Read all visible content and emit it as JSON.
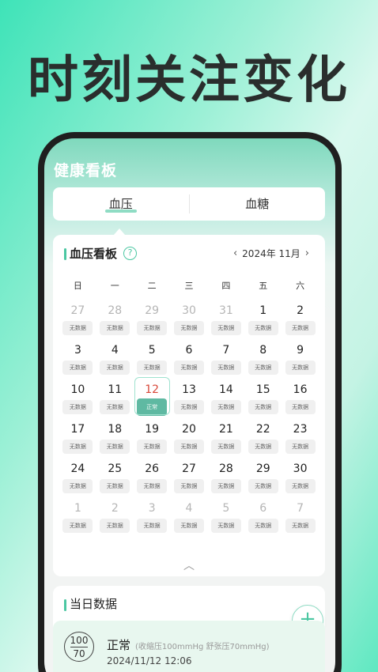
{
  "headline": "时刻关注变化",
  "app": {
    "title": "健康看板",
    "tabs": [
      {
        "label": "血压",
        "active": true
      },
      {
        "label": "血糖",
        "active": false
      }
    ]
  },
  "board": {
    "title": "血压看板",
    "help_icon": "question-circle-icon",
    "month": "2024年 11月",
    "prev_icon": "chevron-left-icon",
    "next_icon": "chevron-right-icon",
    "weekdays": [
      "日",
      "一",
      "二",
      "三",
      "四",
      "五",
      "六"
    ],
    "no_data": "无数据",
    "today_tag": "正常",
    "weeks": [
      [
        {
          "d": "27",
          "o": true
        },
        {
          "d": "28",
          "o": true
        },
        {
          "d": "29",
          "o": true
        },
        {
          "d": "30",
          "o": true
        },
        {
          "d": "31",
          "o": true
        },
        {
          "d": "1"
        },
        {
          "d": "2"
        }
      ],
      [
        {
          "d": "3"
        },
        {
          "d": "4"
        },
        {
          "d": "5"
        },
        {
          "d": "6"
        },
        {
          "d": "7"
        },
        {
          "d": "8"
        },
        {
          "d": "9"
        }
      ],
      [
        {
          "d": "10"
        },
        {
          "d": "11"
        },
        {
          "d": "12",
          "today": true
        },
        {
          "d": "13"
        },
        {
          "d": "14"
        },
        {
          "d": "15"
        },
        {
          "d": "16"
        }
      ],
      [
        {
          "d": "17"
        },
        {
          "d": "18"
        },
        {
          "d": "19"
        },
        {
          "d": "20"
        },
        {
          "d": "21"
        },
        {
          "d": "22"
        },
        {
          "d": "23"
        }
      ],
      [
        {
          "d": "24"
        },
        {
          "d": "25"
        },
        {
          "d": "26"
        },
        {
          "d": "27"
        },
        {
          "d": "28"
        },
        {
          "d": "29"
        },
        {
          "d": "30"
        }
      ],
      [
        {
          "d": "1",
          "o": true
        },
        {
          "d": "2",
          "o": true
        },
        {
          "d": "3",
          "o": true
        },
        {
          "d": "4",
          "o": true
        },
        {
          "d": "5",
          "o": true
        },
        {
          "d": "6",
          "o": true
        },
        {
          "d": "7",
          "o": true
        }
      ]
    ],
    "collapse_icon": "chevron-up-icon"
  },
  "daily": {
    "title": "当日数据",
    "add_label": "+",
    "record": {
      "systolic": "100",
      "diastolic": "70",
      "status": "正常",
      "detail": "(收缩压100mmHg 舒张压70mmHg)",
      "time": "2024/11/12 12:06"
    }
  },
  "colors": {
    "accent": "#4bc7a2",
    "today_tag": "#5fb9a2",
    "today_num": "#d8483a"
  }
}
